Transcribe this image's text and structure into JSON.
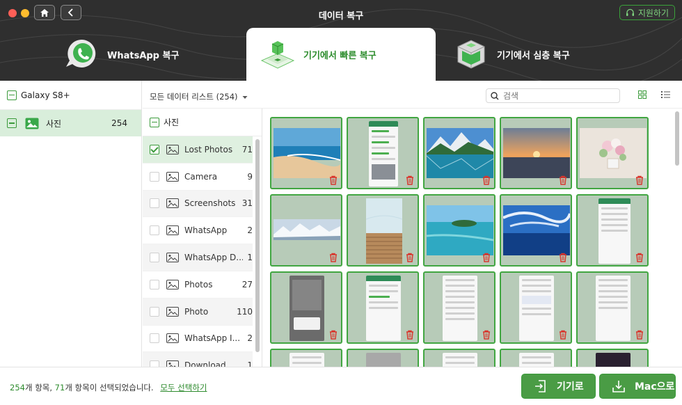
{
  "window": {
    "title": "데이터 복구",
    "support_label": "지원하기"
  },
  "tabs": [
    {
      "label": "WhatsApp 복구",
      "icon": "whatsapp-bubble-icon",
      "active": false
    },
    {
      "label": "기기에서 빠른 복구",
      "icon": "quick-recovery-cube-icon",
      "active": true
    },
    {
      "label": "기기에서 심층 복구",
      "icon": "deep-recovery-cube-icon",
      "active": false
    }
  ],
  "sidebar": {
    "device_name": "Galaxy S8+",
    "category": {
      "label": "사진",
      "count": "254",
      "icon": "photo-icon"
    }
  },
  "toolbar": {
    "filter_label": "모든 데이터 리스트 (254)",
    "search_placeholder": "검색",
    "view_modes": [
      "grid-view-icon",
      "list-view-icon"
    ]
  },
  "albums": {
    "header": "사진",
    "items": [
      {
        "name": "Lost Photos",
        "count": "71",
        "checked": true
      },
      {
        "name": "Camera",
        "count": "9",
        "checked": false
      },
      {
        "name": "Screenshots",
        "count": "31",
        "checked": false
      },
      {
        "name": "WhatsApp",
        "count": "2",
        "checked": false
      },
      {
        "name": "WhatsApp D...",
        "count": "1",
        "checked": false
      },
      {
        "name": "Photos",
        "count": "27",
        "checked": false
      },
      {
        "name": "Photo",
        "count": "110",
        "checked": false
      },
      {
        "name": "WhatsApp I...",
        "count": "2",
        "checked": false
      },
      {
        "name": "Download",
        "count": "1",
        "checked": false
      }
    ]
  },
  "thumbnails": [
    "beach-photo",
    "chat-screenshot",
    "mountain-lake-photo",
    "sunset-photo",
    "flowers-photo",
    "snowy-mountains-photo",
    "boardwalk-photo",
    "tropical-island-photo",
    "ocean-sky-photo",
    "app-screenshot",
    "dialog-screenshot",
    "chat-screenshot",
    "settings-screenshot",
    "settings-screenshot",
    "settings-screenshot"
  ],
  "footer": {
    "total": "254",
    "total_suffix": "개 항목, ",
    "selected": "71",
    "selected_suffix": "개 항목이 선택되었습니다.",
    "select_all_label": "모두 선택하기",
    "to_device_label": "기기로",
    "to_mac_label": "Mac으로"
  },
  "colors": {
    "accent": "#3a9a3a",
    "header_bg": "#2f2f2f",
    "selected_row": "#d9eedb",
    "primary_button": "#4a9c45"
  }
}
